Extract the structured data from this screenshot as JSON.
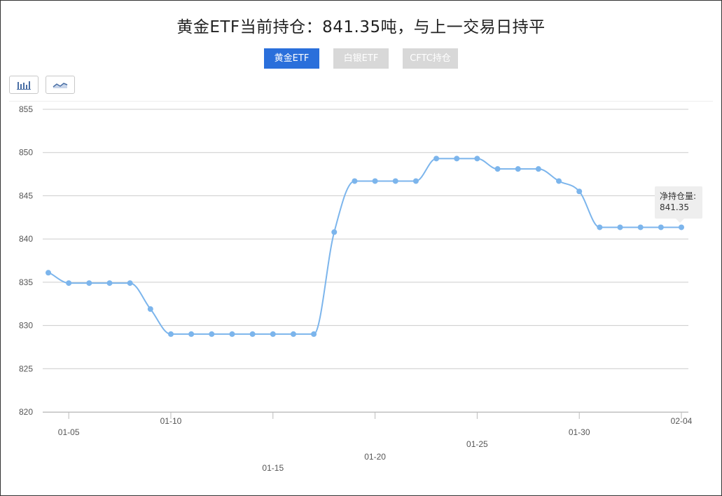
{
  "header": {
    "title": "黄金ETF当前持仓：841.35吨，与上一交易日持平"
  },
  "tabs": [
    {
      "label": "黄金ETF",
      "active": true
    },
    {
      "label": "白银ETF",
      "active": false
    },
    {
      "label": "CFTC持仓",
      "active": false
    }
  ],
  "toolbar": {
    "bar_icon": "bar-chart-icon",
    "line_icon": "line-chart-icon"
  },
  "colors": {
    "accent": "#2a6fdb",
    "series": "#7cb5ec",
    "inactive_tab": "#d8d8d8"
  },
  "tooltip": {
    "label": "净持仓量:",
    "value": "841.35"
  },
  "chart_data": {
    "type": "line",
    "ylim": [
      820,
      855
    ],
    "yticks": [
      820,
      825,
      830,
      835,
      840,
      845,
      850,
      855
    ],
    "xlim": [
      "01-04",
      "02-04"
    ],
    "xticks": [
      "01-05",
      "01-10",
      "01-15",
      "01-20",
      "01-25",
      "01-30",
      "02-04"
    ],
    "grid": true,
    "smooth": true,
    "series": [
      {
        "name": "净持仓量",
        "x": [
          "01-04",
          "01-05",
          "01-06",
          "01-07",
          "01-08",
          "01-09",
          "01-10",
          "01-11",
          "01-12",
          "01-13",
          "01-14",
          "01-15",
          "01-16",
          "01-17",
          "01-18",
          "01-19",
          "01-20",
          "01-21",
          "01-22",
          "01-23",
          "01-24",
          "01-25",
          "01-26",
          "01-27",
          "01-28",
          "01-29",
          "01-30",
          "01-31",
          "02-01",
          "02-02",
          "02-03",
          "02-04"
        ],
        "values": [
          836.1,
          834.9,
          834.9,
          834.9,
          834.9,
          831.9,
          829.0,
          829.0,
          829.0,
          829.0,
          829.0,
          829.0,
          829.0,
          829.0,
          840.8,
          846.7,
          846.7,
          846.7,
          846.7,
          849.3,
          849.3,
          849.3,
          848.1,
          848.1,
          848.1,
          846.7,
          845.5,
          841.35,
          841.35,
          841.35,
          841.35,
          841.35
        ]
      }
    ]
  }
}
